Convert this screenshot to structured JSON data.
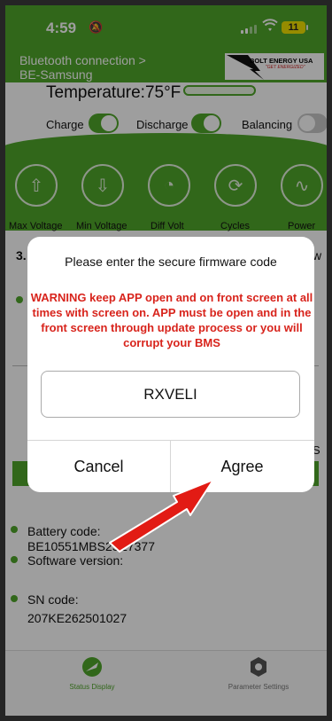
{
  "status_bar": {
    "time": "4:59",
    "battery_level": "11"
  },
  "header": {
    "connection_line1": "Bluetooth connection >",
    "connection_line2": "BE-Samsung",
    "logo_text": "BOLT ENERGY USA",
    "logo_tagline": "\"GET ENERGIZED\""
  },
  "temperature": {
    "label": "Temperature:75°F"
  },
  "toggles": [
    {
      "label": "Charge",
      "state": "on"
    },
    {
      "label": "Discharge",
      "state": "on"
    },
    {
      "label": "Balancing",
      "state": "off"
    }
  ],
  "metrics": [
    {
      "label": "Max Voltage",
      "icon": "arrow-up-icon"
    },
    {
      "label": "Min Voltage",
      "icon": "arrow-down-icon"
    },
    {
      "label": "Diff Volt",
      "icon": "gauge-icon"
    },
    {
      "label": "Cycles",
      "icon": "cycle-icon"
    },
    {
      "label": "Power",
      "icon": "power-wave-icon"
    }
  ],
  "metric_values": {
    "first_partial": "3.",
    "last_partial": "w"
  },
  "right_edge_partial": "S",
  "info": {
    "battery_code_label": "Battery code:",
    "battery_code_value": "BE10551MBS25E7377",
    "software_version_label": "Software version:",
    "sn_code_label": "SN code:",
    "sn_code_value": "207KE262501027"
  },
  "tabs": [
    {
      "label": "Status Display",
      "icon": "battery-status-icon",
      "active": true
    },
    {
      "label": "Parameter Settings",
      "icon": "gear-icon",
      "active": false
    }
  ],
  "dialog": {
    "title": "Please enter the secure firmware code",
    "warning": "WARNING keep APP open and on front screen at all times with screen on. APP must be open and in the front screen through update process or you will corrupt your BMS",
    "input_value": "RXVELI",
    "cancel_label": "Cancel",
    "agree_label": "Agree"
  },
  "colors": {
    "brand_green": "#4fa62a",
    "warning_red": "#d8241c",
    "arrow_red": "#e21b14"
  }
}
